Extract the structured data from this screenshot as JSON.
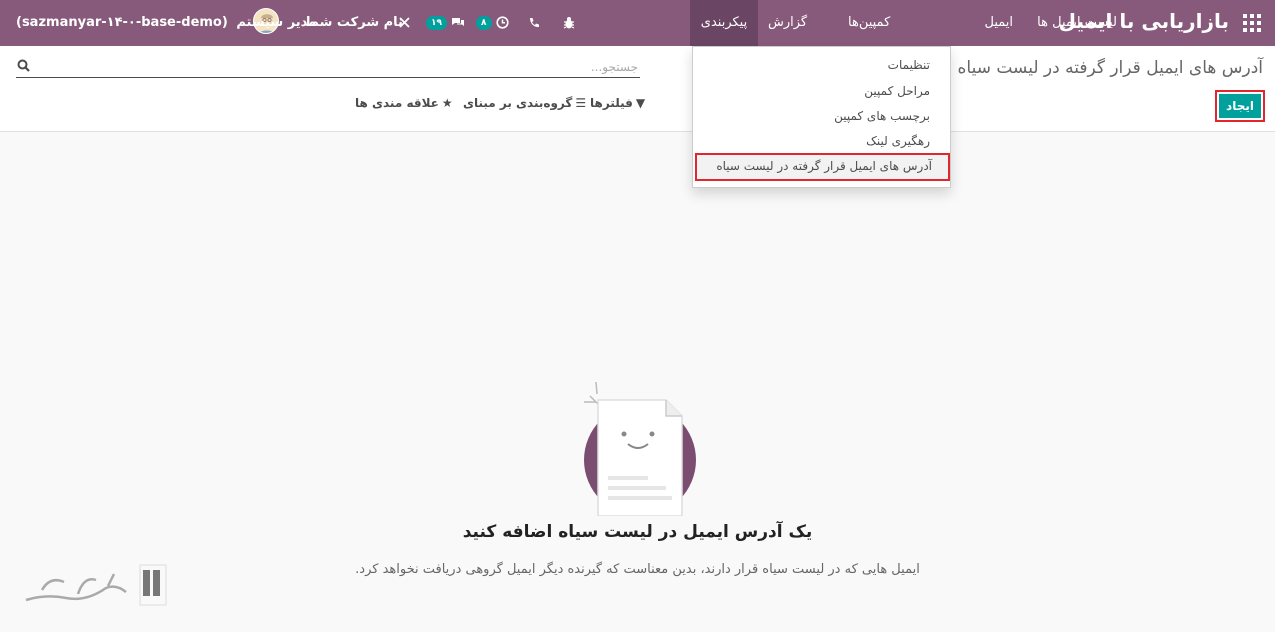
{
  "navbar": {
    "brand": "بازاریابی با ایمیل",
    "menus": [
      "ایمیل",
      "لیست ایمیل ها",
      "کمپین‌ها",
      "گزارش",
      "پیکربندی"
    ],
    "company": "نام شرکت شما",
    "user": "مدیر سیستم",
    "db": "(sazmanyar-۱۴-۰-base-demo)",
    "badge_messages": "۱۹",
    "badge_activities": "۸"
  },
  "config_menu": {
    "items": [
      "تنظیمات",
      "مراحل کمپین",
      "برچسب های کمپین",
      "رهگیری لینک",
      "آدرس های ایمیل قرار گرفته در لیست سیاه"
    ]
  },
  "control_panel": {
    "title": "آدرس های ایمیل قرار گرفته در لیست سیاه",
    "create_label": "ایجاد",
    "search_placeholder": "جستجو...",
    "filters_label": "فیلترها",
    "groupby_label": "گروه‌بندی بر مبنای",
    "favorites_label": "علاقه مندی ها"
  },
  "empty_state": {
    "title": "یک آدرس ایمیل در لیست سیاه اضافه کنید",
    "text": "ایمیل هایی که در لیست سیاه قرار دارند، بدین معناست که گیرنده دیگر ایمیل گروهی دریافت نخواهد کرد."
  },
  "watermark": {
    "text": "تسهیل‌گستر"
  },
  "colors": {
    "navbar": "#875a7b",
    "accent": "#00a09d",
    "highlight": "#e0262f"
  }
}
